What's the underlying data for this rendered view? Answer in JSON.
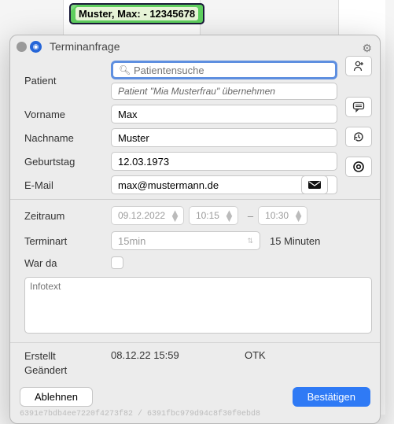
{
  "calendar_chip": {
    "name": "Muster, Max:",
    "id": "- 12345678"
  },
  "dialog": {
    "title": "Terminanfrage",
    "patient": {
      "label": "Patient",
      "search_placeholder": "Patientensuche",
      "takeover_hint": "Patient \"Mia Musterfrau\" übernehmen"
    },
    "vorname": {
      "label": "Vorname",
      "value": "Max"
    },
    "nachname": {
      "label": "Nachname",
      "value": "Muster"
    },
    "geburtstag": {
      "label": "Geburtstag",
      "value": "12.03.1973"
    },
    "email": {
      "label": "E-Mail",
      "value": "max@mustermann.de"
    },
    "zeitraum": {
      "label": "Zeitraum",
      "date": "09.12.2022",
      "from": "10:15",
      "to": "10:30"
    },
    "terminart": {
      "label": "Terminart",
      "value": "15min",
      "duration": "15 Minuten"
    },
    "war_da": {
      "label": "War da",
      "checked": false
    },
    "infotext_placeholder": "Infotext",
    "erstellt": {
      "label": "Erstellt",
      "value": "08.12.22 15:59",
      "source": "OTK"
    },
    "geaendert": {
      "label": "Geändert"
    },
    "buttons": {
      "reject": "Ablehnen",
      "confirm": "Bestätigen"
    },
    "hash": "6391e7bdb4ee7220f4273f82 / 6391fbc979d94c8f30f0ebd8"
  }
}
